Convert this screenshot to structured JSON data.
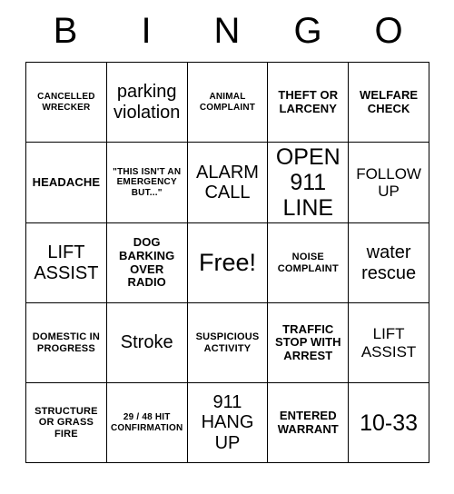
{
  "header": {
    "letters": [
      "B",
      "I",
      "N",
      "G",
      "O"
    ]
  },
  "grid": {
    "rows": [
      [
        {
          "text": "CANCELLED WRECKER",
          "size": "fs-xs"
        },
        {
          "text": "parking violation",
          "size": "fs-xl"
        },
        {
          "text": "ANIMAL COMPLAINT",
          "size": "fs-xs"
        },
        {
          "text": "THEFT OR LARCENY",
          "size": "fs-m"
        },
        {
          "text": "WELFARE CHECK",
          "size": "fs-m"
        }
      ],
      [
        {
          "text": "HEADACHE",
          "size": "fs-m"
        },
        {
          "text": "\"THIS ISN'T AN EMERGENCY BUT...\"",
          "size": "fs-xs"
        },
        {
          "text": "ALARM CALL",
          "size": "fs-xl"
        },
        {
          "text": "OPEN 911 LINE",
          "size": "fs-xxl"
        },
        {
          "text": "FOLLOW UP",
          "size": "fs-l"
        }
      ],
      [
        {
          "text": "LIFT ASSIST",
          "size": "fs-xl"
        },
        {
          "text": "DOG BARKING OVER RADIO",
          "size": "fs-m"
        },
        {
          "text": "Free!",
          "size": "fs-free"
        },
        {
          "text": "NOISE COMPLAINT",
          "size": "fs-s"
        },
        {
          "text": "water rescue",
          "size": "fs-xl"
        }
      ],
      [
        {
          "text": "DOMESTIC IN PROGRESS",
          "size": "fs-s"
        },
        {
          "text": "Stroke",
          "size": "fs-xl"
        },
        {
          "text": "SUSPICIOUS ACTIVITY",
          "size": "fs-s"
        },
        {
          "text": "TRAFFIC STOP WITH ARREST",
          "size": "fs-m"
        },
        {
          "text": "LIFT ASSIST",
          "size": "fs-l"
        }
      ],
      [
        {
          "text": "STRUCTURE OR GRASS FIRE",
          "size": "fs-s"
        },
        {
          "text": "29 / 48 HIT CONFIRMATION",
          "size": "fs-xs"
        },
        {
          "text": "911 HANG UP",
          "size": "fs-xl"
        },
        {
          "text": "ENTERED WARRANT",
          "size": "fs-m"
        },
        {
          "text": "10-33",
          "size": "fs-xxl"
        }
      ]
    ]
  }
}
